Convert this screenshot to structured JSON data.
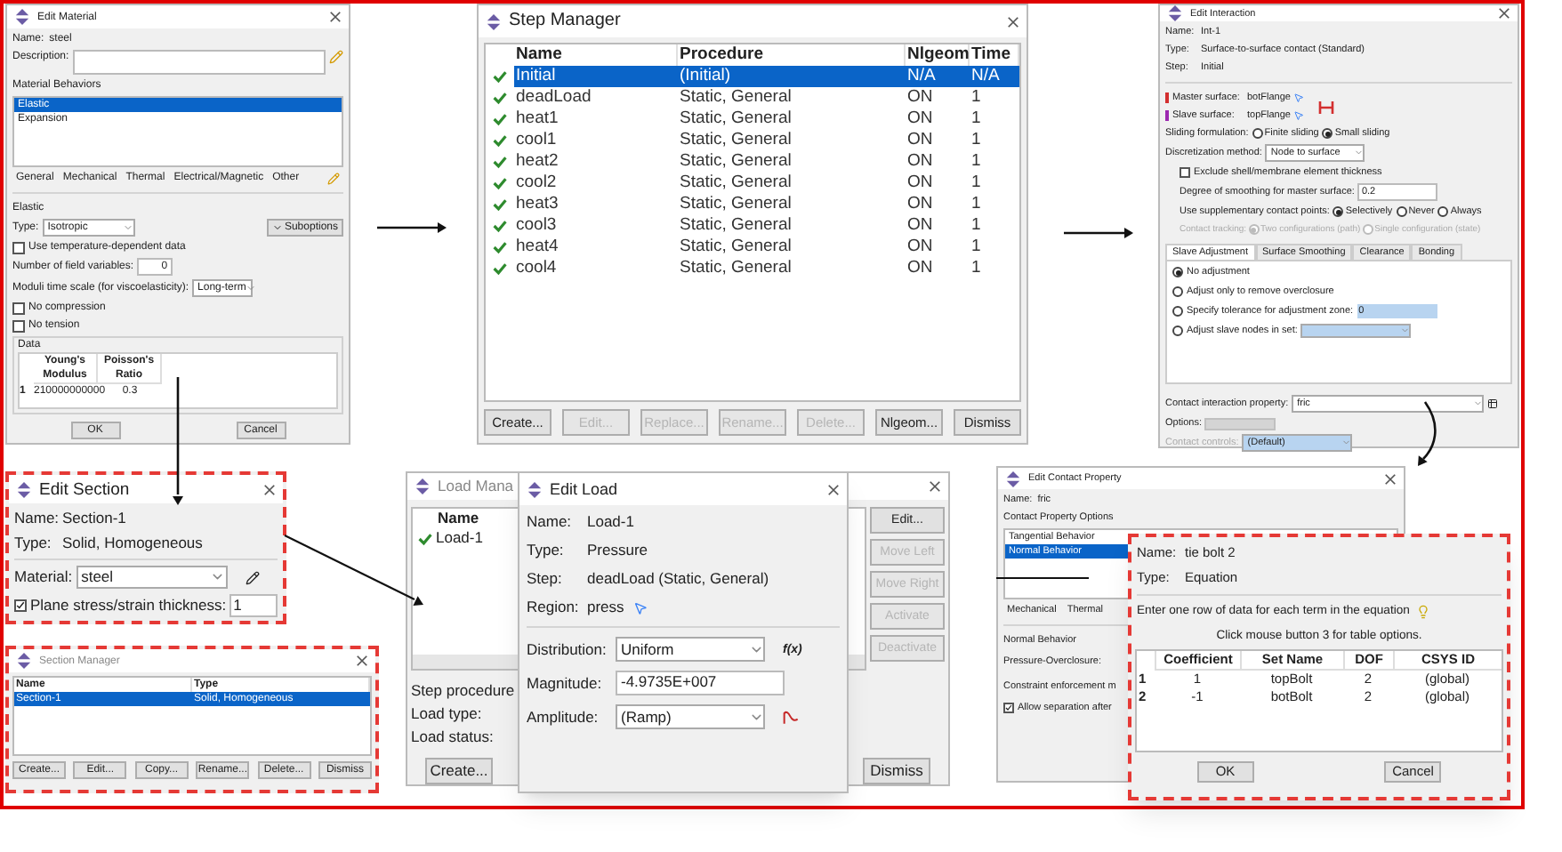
{
  "edit_material": {
    "title": "Edit Material",
    "name_label": "Name:",
    "name": "steel",
    "description_label": "Description:",
    "behaviors_label": "Material Behaviors",
    "behaviors": [
      {
        "label": "Elastic",
        "selected": true
      },
      {
        "label": "Expansion",
        "selected": false
      }
    ],
    "menus": [
      "General",
      "Mechanical",
      "Thermal",
      "Electrical/Magnetic",
      "Other"
    ],
    "group_label": "Elastic",
    "type_label": "Type:",
    "type": "Isotropic",
    "suboptions": "Suboptions",
    "temp_dependent": {
      "label": "Use temperature-dependent data",
      "checked": false
    },
    "field_vars_label": "Number of field variables:",
    "field_vars": "0",
    "moduli_label": "Moduli time scale (for viscoelasticity):",
    "moduli": "Long-term",
    "no_compression": {
      "label": "No compression",
      "checked": false
    },
    "no_tension": {
      "label": "No tension",
      "checked": false
    },
    "data_label": "Data",
    "table": {
      "columns": [
        "Young's Modulus",
        "Poisson's Ratio"
      ],
      "rows": [
        {
          "index": "1",
          "cells": [
            "210000000000",
            "0.3"
          ]
        }
      ]
    },
    "buttons": [
      "OK",
      "Cancel"
    ]
  },
  "step_manager": {
    "title": "Step Manager",
    "columns": [
      "Name",
      "Procedure",
      "Nlgeom",
      "Time"
    ],
    "rows": [
      {
        "name": "Initial",
        "procedure": "(Initial)",
        "nlgeom": "N/A",
        "time": "N/A",
        "selected": true
      },
      {
        "name": "deadLoad",
        "procedure": "Static, General",
        "nlgeom": "ON",
        "time": "1",
        "selected": false
      },
      {
        "name": "heat1",
        "procedure": "Static, General",
        "nlgeom": "ON",
        "time": "1",
        "selected": false
      },
      {
        "name": "cool1",
        "procedure": "Static, General",
        "nlgeom": "ON",
        "time": "1",
        "selected": false
      },
      {
        "name": "heat2",
        "procedure": "Static, General",
        "nlgeom": "ON",
        "time": "1",
        "selected": false
      },
      {
        "name": "cool2",
        "procedure": "Static, General",
        "nlgeom": "ON",
        "time": "1",
        "selected": false
      },
      {
        "name": "heat3",
        "procedure": "Static, General",
        "nlgeom": "ON",
        "time": "1",
        "selected": false
      },
      {
        "name": "cool3",
        "procedure": "Static, General",
        "nlgeom": "ON",
        "time": "1",
        "selected": false
      },
      {
        "name": "heat4",
        "procedure": "Static, General",
        "nlgeom": "ON",
        "time": "1",
        "selected": false
      },
      {
        "name": "cool4",
        "procedure": "Static, General",
        "nlgeom": "ON",
        "time": "1",
        "selected": false
      }
    ],
    "buttons": [
      {
        "label": "Create...",
        "disabled": false
      },
      {
        "label": "Edit...",
        "disabled": true
      },
      {
        "label": "Replace...",
        "disabled": true
      },
      {
        "label": "Rename...",
        "disabled": true
      },
      {
        "label": "Delete...",
        "disabled": true
      },
      {
        "label": "Nlgeom...",
        "disabled": false
      },
      {
        "label": "Dismiss",
        "disabled": false
      }
    ]
  },
  "edit_interaction": {
    "title": "Edit Interaction",
    "info": [
      {
        "label": "Name:",
        "value": "Int-1"
      },
      {
        "label": "Type:",
        "value": "Surface-to-surface contact (Standard)"
      },
      {
        "label": "Step:",
        "value": "Initial"
      }
    ],
    "surfaces": [
      {
        "label": "Master surface:",
        "value": "botFlange",
        "color": "#d32f2f"
      },
      {
        "label": "Slave surface:",
        "value": "topFlange",
        "color": "#9c27b0"
      }
    ],
    "sliding": {
      "label": "Sliding formulation:",
      "options": [
        {
          "label": "Finite sliding",
          "selected": false
        },
        {
          "label": "Small sliding",
          "selected": true
        }
      ]
    },
    "discretization": {
      "label": "Discretization method:",
      "value": "Node to surface"
    },
    "exclude_thickness": {
      "label": "Exclude shell/membrane element thickness",
      "checked": false
    },
    "smoothing": {
      "label": "Degree of smoothing for master surface:",
      "value": "0.2"
    },
    "supplementary": {
      "label": "Use supplementary contact points:",
      "options": [
        {
          "label": "Selectively",
          "selected": true
        },
        {
          "label": "Never",
          "selected": false
        },
        {
          "label": "Always",
          "selected": false
        }
      ]
    },
    "tracking": {
      "label": "Contact tracking:",
      "disabled": true,
      "options": [
        {
          "label": "Two configurations (path)",
          "selected": true
        },
        {
          "label": "Single configuration (state)",
          "selected": false
        }
      ]
    },
    "tabs": [
      {
        "label": "Slave Adjustment",
        "selected": true
      },
      {
        "label": "Surface Smoothing",
        "selected": false
      },
      {
        "label": "Clearance",
        "selected": false
      },
      {
        "label": "Bonding",
        "selected": false
      }
    ],
    "adjustments": [
      {
        "kind": "plain",
        "label": "No adjustment",
        "selected": true
      },
      {
        "kind": "plain",
        "label": "Adjust only to remove overclosure",
        "selected": false
      },
      {
        "kind": "field",
        "label": "Specify tolerance for adjustment zone:",
        "value": "0",
        "selected": false
      },
      {
        "kind": "select",
        "label": "Adjust slave nodes in set:",
        "selected": false
      }
    ],
    "property": {
      "label": "Contact interaction property:",
      "value": "fric"
    },
    "options_label": "Options:",
    "controls": {
      "label": "Contact controls:",
      "value": "(Default)",
      "disabled": true
    }
  },
  "edit_section": {
    "title": "Edit Section",
    "info": [
      {
        "label": "Name:",
        "value": "Section-1"
      },
      {
        "label": "Type:",
        "value": "Solid, Homogeneous"
      }
    ],
    "material_label": "Material:",
    "material": "steel",
    "thickness": {
      "label": "Plane stress/strain thickness:",
      "checked": true,
      "value": "1"
    }
  },
  "section_manager": {
    "title": "Section Manager",
    "columns": [
      "Name",
      "Type"
    ],
    "rows": [
      {
        "name": "Section-1",
        "type": "Solid, Homogeneous",
        "selected": true
      }
    ],
    "buttons": [
      "Create...",
      "Edit...",
      "Copy...",
      "Rename...",
      "Delete...",
      "Dismiss"
    ]
  },
  "load_manager": {
    "title": "Load Mana",
    "columns": [
      "Name"
    ],
    "rows": [
      {
        "name": "Load-1"
      }
    ],
    "side_buttons": [
      {
        "label": "Edit...",
        "disabled": false
      },
      {
        "label": "Move Left",
        "disabled": true
      },
      {
        "label": "Move Right",
        "disabled": true
      },
      {
        "label": "Activate",
        "disabled": true
      },
      {
        "label": "Deactivate",
        "disabled": true
      }
    ],
    "labels": [
      "Step procedure",
      "Load type:",
      "Load status:"
    ],
    "buttons": [
      "Create...",
      "Dismiss"
    ]
  },
  "edit_load": {
    "title": "Edit Load",
    "info": [
      {
        "label": "Name:",
        "value": "Load-1"
      },
      {
        "label": "Type:",
        "value": "Pressure"
      },
      {
        "label": "Step:",
        "value": "deadLoad (Static, General)"
      },
      {
        "label": "Region:",
        "value": "press"
      }
    ],
    "distribution_label": "Distribution:",
    "distribution": "Uniform",
    "fx": "f(x)",
    "magnitude_label": "Magnitude:",
    "magnitude": "-4.9735E+007",
    "amplitude_label": "Amplitude:",
    "amplitude": "(Ramp)"
  },
  "edit_contact_property": {
    "title": "Edit Contact Property",
    "name_label": "Name:",
    "name": "fric",
    "options_label": "Contact Property Options",
    "options": [
      {
        "label": "Tangential Behavior",
        "selected": false
      },
      {
        "label": "Normal Behavior",
        "selected": true
      }
    ],
    "menus": [
      "Mechanical",
      "Thermal"
    ],
    "group_label": "Normal Behavior",
    "labels": [
      "Pressure-Overclosure:",
      "Constraint enforcement m"
    ],
    "separation": {
      "label": "Allow separation after",
      "checked": true
    }
  },
  "equation": {
    "info": [
      {
        "label": "Name:",
        "value": "tie bolt 2"
      },
      {
        "label": "Type:",
        "value": "Equation"
      }
    ],
    "instruction": "Enter one row of data for each term in the equation",
    "hint": "Click mouse button 3 for table options.",
    "table": {
      "columns": [
        "Coefficient",
        "Set Name",
        "DOF",
        "CSYS ID"
      ],
      "rows": [
        {
          "index": "1",
          "cells": [
            "1",
            "topBolt",
            "2",
            "(global)"
          ]
        },
        {
          "index": "2",
          "cells": [
            "-1",
            "botBolt",
            "2",
            "(global)"
          ]
        }
      ]
    },
    "buttons": [
      "OK",
      "Cancel"
    ]
  }
}
